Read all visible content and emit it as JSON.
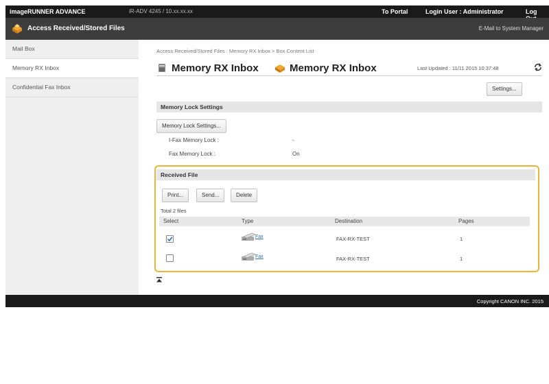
{
  "topbar": {
    "brand": "imageRUNNER ADVANCE",
    "device": "iR-ADV 4245 / 10.xx.xx.xx",
    "portal": "To Portal",
    "login": "Login User : Administrator",
    "logout": "Log Out"
  },
  "titlebar": {
    "title": "Access Received/Stored Files",
    "email_link": "E-Mail to System Manager"
  },
  "sidebar": {
    "items": [
      {
        "label": "Mail Box"
      },
      {
        "label": "Memory RX Inbox"
      },
      {
        "label": "Confidential Fax Inbox"
      }
    ]
  },
  "main": {
    "breadcrumb": "Access Received/Stored Files : Memory RX Inbox > Box Content List",
    "title": "Memory RX Inbox",
    "title_repeat": "Memory RX Inbox",
    "last_updated": "Last Updated : 11/11 2015 10:37:48",
    "settings_btn": "Settings...",
    "memory_lock": {
      "header": "Memory Lock Settings",
      "btn": "Memory Lock Settings...",
      "ifax_label": "I-Fax Memory Lock :",
      "ifax_value": "-",
      "fax_label": "Fax Memory Lock :",
      "fax_value": "On"
    },
    "received": {
      "header": "Received File",
      "print_btn": "Print...",
      "send_btn": "Send...",
      "delete_btn": "Delete",
      "total": "Total 2 files",
      "columns": [
        "Select",
        "Type",
        "Destination",
        "Pages"
      ],
      "rows": [
        {
          "checked": true,
          "type": "Fax",
          "destination": "FAX-RX-TEST",
          "pages": "1"
        },
        {
          "checked": false,
          "type": "Fax",
          "destination": "FAX-RX-TEST",
          "pages": "1"
        }
      ]
    }
  },
  "footer": {
    "copyright": "Copyright CANON INC. 2015"
  },
  "colors": {
    "highlight": "#f2b23a",
    "accent": "#e08a1e",
    "link": "#2a6fb1"
  }
}
